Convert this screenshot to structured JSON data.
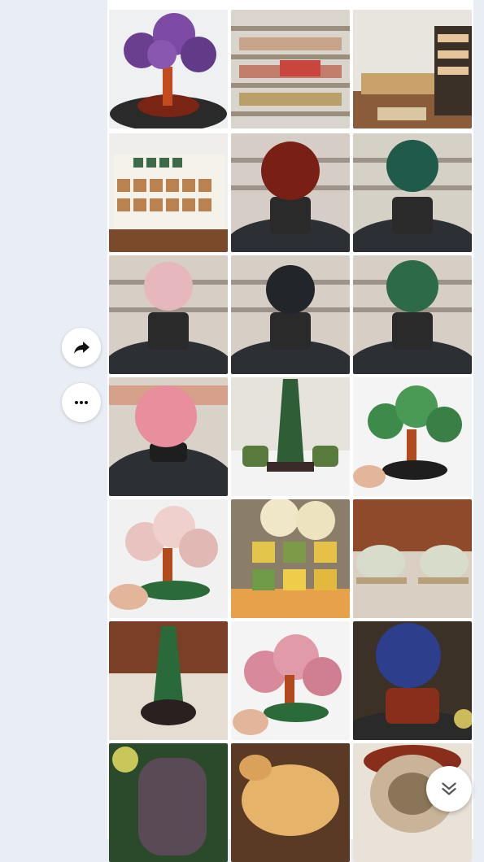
{
  "gallery": {
    "columns": 3,
    "tiles": [
      {
        "icon": "amethyst-tree-photo"
      },
      {
        "icon": "shop-shelves-photo"
      },
      {
        "icon": "store-interior-photo"
      },
      {
        "icon": "crystal-tray-photo"
      },
      {
        "icon": "red-sphere-photo",
        "color": "#7a1f16"
      },
      {
        "icon": "green-sphere-photo",
        "color": "#1f5a4a"
      },
      {
        "icon": "pink-sphere-photo",
        "color": "#e6b7bd"
      },
      {
        "icon": "black-sphere-photo",
        "color": "#22262a"
      },
      {
        "icon": "green-sphere-photo",
        "color": "#2d6a48"
      },
      {
        "icon": "rose-quartz-sphere-photo",
        "color": "#e88e9c"
      },
      {
        "icon": "jade-pagoda-photo",
        "color": "#2f5e36"
      },
      {
        "icon": "jade-money-tree-photo",
        "color": "#3e8a4a"
      },
      {
        "icon": "rose-quartz-tree-photo",
        "color": "#e8c3c0"
      },
      {
        "icon": "jade-figurines-photo",
        "color": "#e2c54a"
      },
      {
        "icon": "jade-dragon-photo",
        "color": "#d7dccb"
      },
      {
        "icon": "jade-pagoda-photo",
        "color": "#2a6a3a"
      },
      {
        "icon": "pink-crystal-tree-photo",
        "color": "#d98a9a"
      },
      {
        "icon": "sodalite-sphere-photo",
        "color": "#2c3e8c"
      },
      {
        "icon": "amethyst-geode-photo",
        "color": "#5a4a55"
      },
      {
        "icon": "carved-ox-photo",
        "color": "#e6b36a"
      },
      {
        "icon": "agate-slice-photo",
        "color": "#c9b49a"
      }
    ]
  },
  "actions": {
    "share_icon": "share-icon",
    "more_icon": "more-icon",
    "scroll_icon": "scroll-down-icon"
  }
}
